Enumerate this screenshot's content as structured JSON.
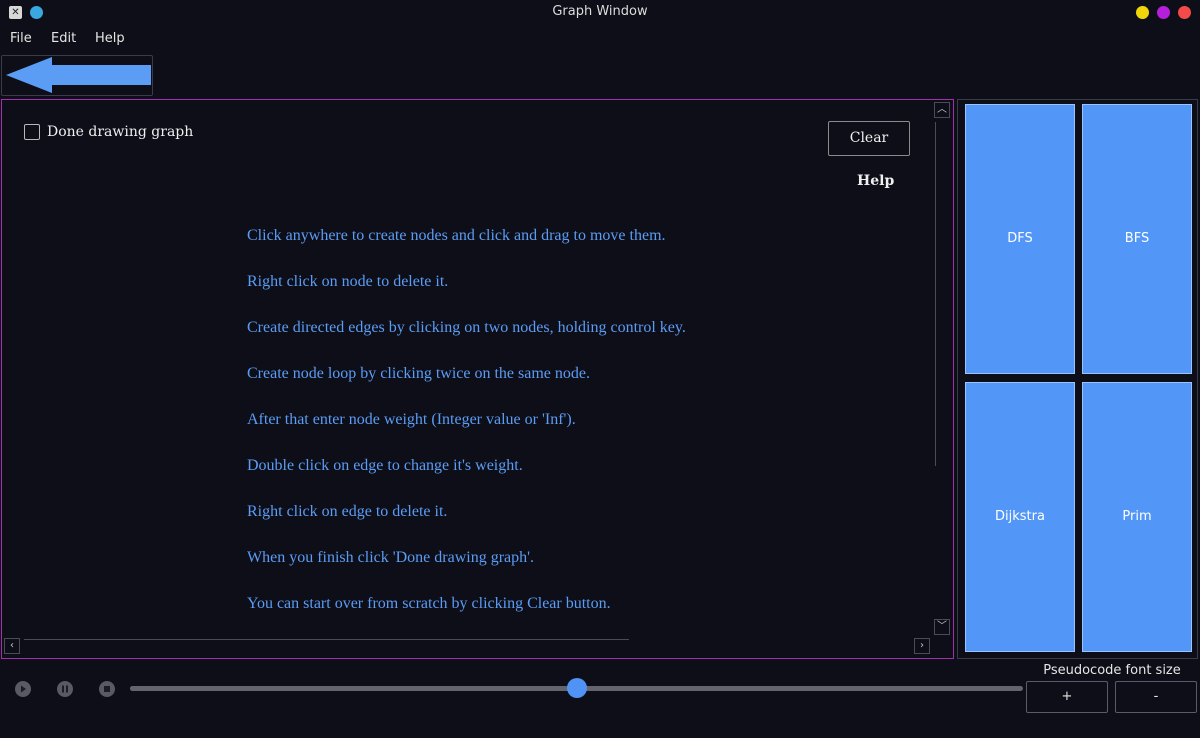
{
  "window": {
    "title": "Graph Window",
    "app_icon": "x-icon",
    "controls": [
      {
        "name": "minimize",
        "color": "#f2d40a"
      },
      {
        "name": "maximize",
        "color": "#b51fd9"
      },
      {
        "name": "close",
        "color": "#f44a4a"
      }
    ]
  },
  "menu": {
    "items": [
      "File",
      "Edit",
      "Help"
    ]
  },
  "toolbar": {
    "back_icon": "left-arrow-icon",
    "accent": "#5b9cf5"
  },
  "canvas": {
    "done_label": "Done drawing graph",
    "done_checked": false,
    "clear_label": "Clear",
    "help_title": "Help",
    "border_color": "#a12fae",
    "instructions": [
      "Click anywhere to create nodes and click and drag to move them.",
      "Right click on node to delete it.",
      "Create directed edges by clicking on two nodes, holding control key.",
      "Create node loop by clicking twice on the same node.",
      "After that enter node weight (Integer value or 'Inf').",
      "Double click on edge to change it's weight.",
      "Right click on edge to delete it.",
      "When you finish click 'Done drawing graph'.",
      "You can start over from scratch by clicking Clear button."
    ]
  },
  "algorithms": {
    "buttons": [
      "DFS",
      "BFS",
      "Dijkstra",
      "Prim"
    ],
    "color": "#5297f7"
  },
  "playback": {
    "play_icon": "play-icon",
    "pause_icon": "pause-icon",
    "stop_icon": "stop-icon",
    "progress": 0.5
  },
  "pseudocode": {
    "label": "Pseudocode font size",
    "increase_label": "+",
    "decrease_label": "-"
  }
}
